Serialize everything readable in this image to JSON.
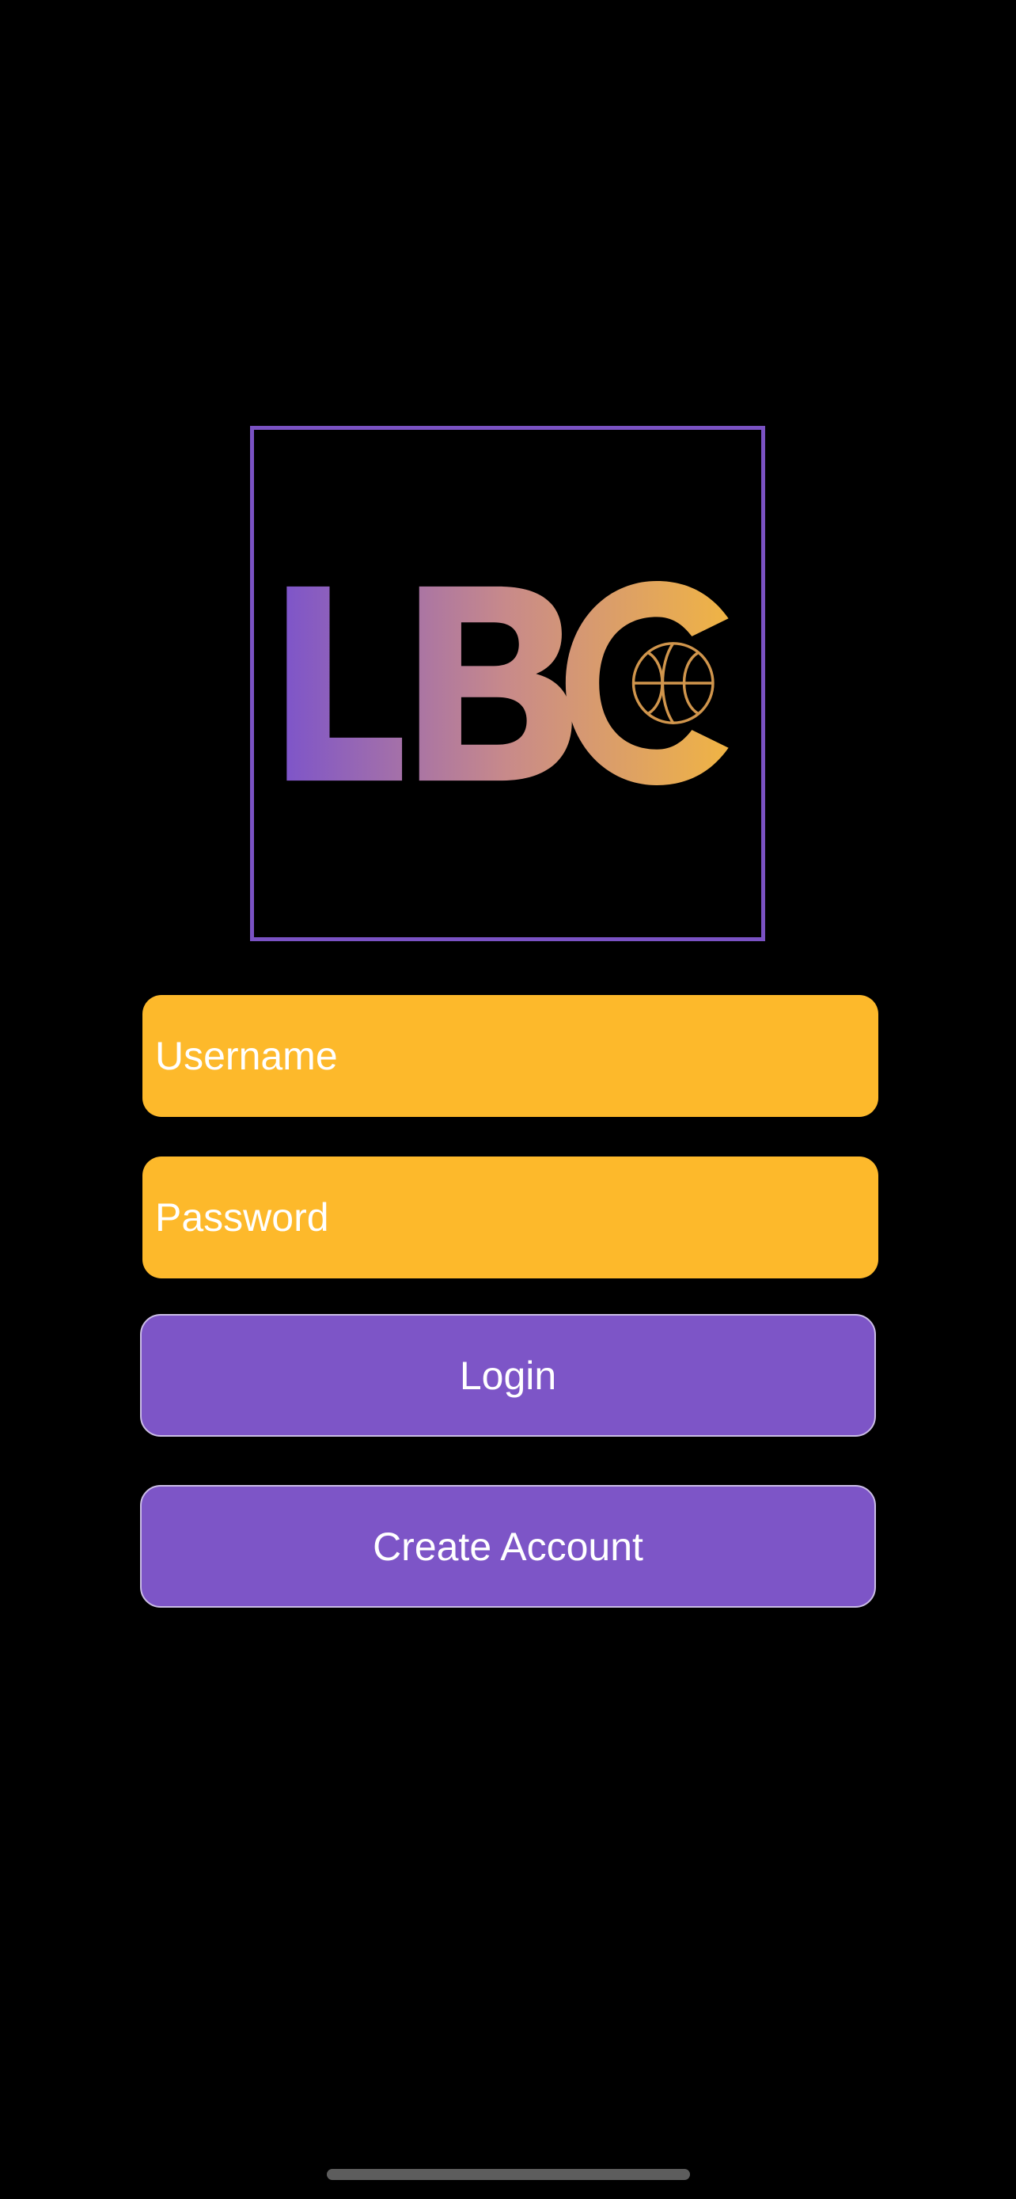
{
  "logo": {
    "letters": [
      "L",
      "B",
      "C"
    ],
    "icon": "basketball-icon",
    "frame_color": "#7a52c3",
    "gradient_start": "#7e55c9",
    "gradient_end": "#f0b444"
  },
  "login_form": {
    "username_placeholder": "Username",
    "username_value": "",
    "password_placeholder": "Password",
    "password_value": "",
    "field_color": "#fdb92b"
  },
  "buttons": {
    "login_label": "Login",
    "create_account_label": "Create Account",
    "button_color": "#7d55c7"
  }
}
